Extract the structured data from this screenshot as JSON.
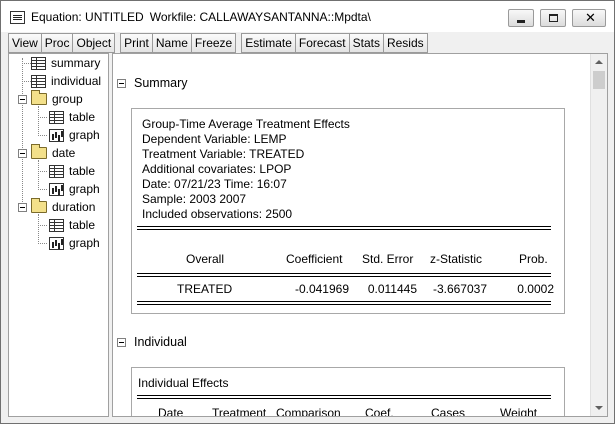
{
  "window": {
    "title_prefix": "Equation: UNTITLED",
    "workfile": "Workfile: CALLAWAYSANTANNA::Mpdta\\"
  },
  "toolbar": {
    "group1": [
      "View",
      "Proc",
      "Object"
    ],
    "group2": [
      "Print",
      "Name",
      "Freeze"
    ],
    "group3": [
      "Estimate",
      "Forecast",
      "Stats",
      "Resids"
    ]
  },
  "tree": {
    "summary": "summary",
    "individual": "individual",
    "group": "group",
    "group_table": "table",
    "group_graph": "graph",
    "date": "date",
    "date_table": "table",
    "date_graph": "graph",
    "duration": "duration",
    "duration_table": "table",
    "duration_graph": "graph"
  },
  "summary": {
    "section_label": "Summary",
    "header_lines": [
      "Group-Time Average Treatment Effects",
      "Dependent Variable: LEMP",
      "Treatment Variable: TREATED",
      "Additional covariates:  LPOP",
      "Date: 07/21/23   Time: 16:07",
      "Sample: 2003 2007",
      "Included observations: 2500"
    ],
    "columns": [
      "Overall",
      "Coefficient",
      "Std. Error",
      "z-Statistic",
      "Prob."
    ],
    "row": [
      "TREATED",
      "-0.041969",
      "0.011445",
      "-3.667037",
      "0.0002"
    ]
  },
  "individual": {
    "section_label": "Individual",
    "title": "Individual Effects",
    "columns": [
      "Date",
      "Treatment",
      "Comparison",
      "Coef.",
      "Cases",
      "Weight"
    ]
  }
}
